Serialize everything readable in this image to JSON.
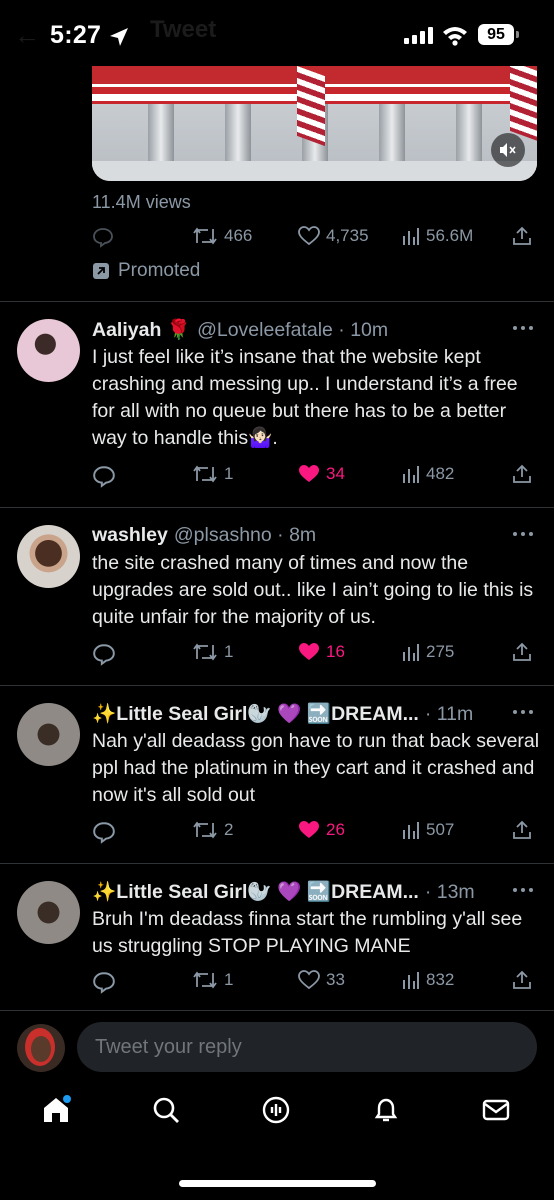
{
  "status_bar": {
    "time": "5:27",
    "battery": "95",
    "background_title": "Tweet"
  },
  "promoted_tweet": {
    "views": "11.4M views",
    "retweets": "466",
    "likes": "4,735",
    "analytics": "56.6M",
    "promoted_label": "Promoted"
  },
  "tweets": [
    {
      "name": "Aaliyah 🌹",
      "handle": "@Loveleefatale · 10m",
      "text": "I just feel like it’s insane that the website kept crashing and messing up.. I understand it’s a free for all with no queue but there has to be a better way to handle this🤷🏻‍♀️.",
      "retweets": "1",
      "likes": "34",
      "liked": true,
      "views": "482"
    },
    {
      "name": "washley",
      "handle": "@plsashno · 8m",
      "text": "the site crashed many of times and now the upgrades are sold out.. like I ain’t going to lie this is quite unfair for the majority of us.",
      "retweets": "1",
      "likes": "16",
      "liked": true,
      "views": "275"
    },
    {
      "name": "✨Little Seal Girl🦭 💜 🔜DREAM...",
      "handle": "· 11m",
      "text": "Nah y'all deadass gon have to run that back several ppl had the platinum in they cart and it crashed and now it's all sold out",
      "retweets": "2",
      "likes": "26",
      "liked": true,
      "views": "507"
    },
    {
      "name": "✨Little Seal Girl🦭 💜 🔜DREAM...",
      "handle": "· 13m",
      "text": "Bruh I'm deadass finna start the rumbling y'all see us struggling STOP PLAYING MANE",
      "retweets": "1",
      "likes": "33",
      "liked": false,
      "views": "832"
    }
  ],
  "reply_box": {
    "placeholder": "Tweet your reply"
  },
  "tab_bar": {
    "items": [
      "home-icon",
      "search-icon",
      "spaces-icon",
      "notifications-icon",
      "messages-icon"
    ]
  },
  "colors": {
    "like_active": "#f91880",
    "secondary_text": "#8b98a5",
    "accent": "#1d9bf0"
  }
}
